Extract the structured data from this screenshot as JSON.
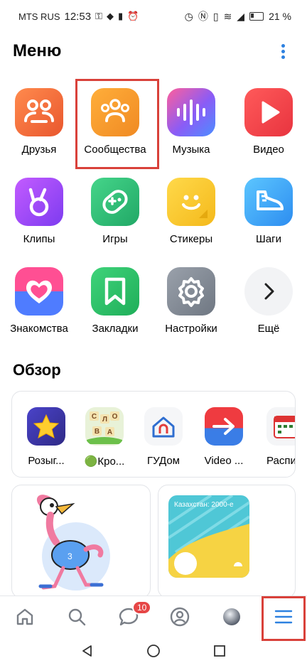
{
  "status": {
    "carrier": "MTS RUS",
    "time": "12:53",
    "battery": "21 %"
  },
  "header": {
    "title": "Меню"
  },
  "apps": [
    {
      "label": "Друзья"
    },
    {
      "label": "Сообщества"
    },
    {
      "label": "Музыка"
    },
    {
      "label": "Видео"
    },
    {
      "label": "Клипы"
    },
    {
      "label": "Игры"
    },
    {
      "label": "Стикеры"
    },
    {
      "label": "Шаги"
    },
    {
      "label": "Знакомства"
    },
    {
      "label": "Закладки"
    },
    {
      "label": "Настройки"
    },
    {
      "label": "Ещё"
    }
  ],
  "overview": {
    "title": "Обзор",
    "items": [
      {
        "label": "Розыг..."
      },
      {
        "label": "🟢Кро..."
      },
      {
        "label": "ГУДом"
      },
      {
        "label": "Video ..."
      },
      {
        "label": "Распи"
      }
    ],
    "card2_text": "Казахстан: 2000-е"
  },
  "tabbar": {
    "messages_badge": "10"
  },
  "colors": {
    "accent": "#2d81e0",
    "highlight": "#d9413a"
  }
}
